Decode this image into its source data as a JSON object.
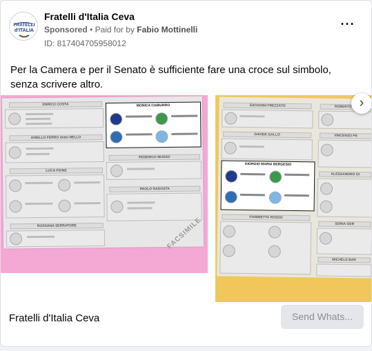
{
  "post": {
    "page_name": "Fratelli d'Italia Ceva",
    "sponsored": "Sponsored",
    "separator": "•",
    "paid_for_by_prefix": "Paid for by",
    "payer": "Fabio Mottinelli",
    "ad_id": "ID: 817404705958012",
    "more_icon": "more-horizontal-icon",
    "body_text": "Per la Camera e per il Senato è sufficiente fare una croce sul simbolo, senza scrivere altro."
  },
  "avatar": {
    "line1": "FRATELLI",
    "line2": "d'ITALIA"
  },
  "carousel": {
    "slide1": {
      "candidates": [
        "ENRICO COSTA",
        "ANIELLO FERRO detto NELLO",
        "LUCA FIONE",
        "ROSSANA SERRATORE",
        "MONICA CIABURRO",
        "FEDERICO MUSSO",
        "PAOLO RADOSTA"
      ],
      "stamp": "FACSIMILE"
    },
    "slide2": {
      "candidates": [
        "GIOVANNI FREZZATO",
        "DAVIDE GALLO",
        "GIORGIO MARIA BERGESIO",
        "FIAMMETTA ROSSO",
        "ROBERTO RA",
        "VINCENZO PE",
        "ALESSANDRO GI",
        "SONIA GER",
        "MICHELE BAR"
      ]
    },
    "next_icon": "chevron-right-icon"
  },
  "footer": {
    "name": "Fratelli d'Italia Ceva",
    "cta_label": "Send Whats..."
  },
  "colors": {
    "slide1_bg": "#f4a9d4",
    "slide2_bg": "#f1c75b",
    "fdi_blue": "#1f3a8a"
  }
}
